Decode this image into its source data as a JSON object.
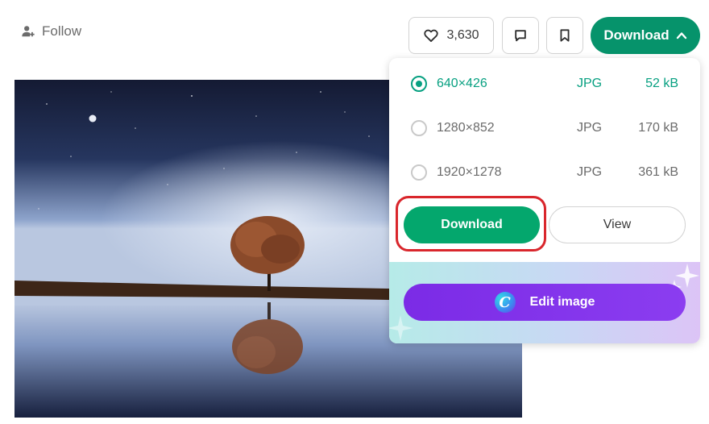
{
  "header": {
    "follow_label": "Follow",
    "like_count": "3,630",
    "download_label": "Download"
  },
  "photo": {
    "alt": "Lone tree at night reflected in water under a starry sky with the moon"
  },
  "dropdown": {
    "sizes": [
      {
        "dims": "640×426",
        "format": "JPG",
        "size": "52 kB",
        "selected": true
      },
      {
        "dims": "1280×852",
        "format": "JPG",
        "size": "170 kB",
        "selected": false
      },
      {
        "dims": "1920×1278",
        "format": "JPG",
        "size": "361 kB",
        "selected": false
      }
    ],
    "download_label": "Download",
    "view_label": "View",
    "edit_label": "Edit image",
    "canva_letter": "C"
  },
  "colors": {
    "accent_green": "#07a081",
    "download_green": "#04a76d",
    "edit_purple": "#7d2ae8",
    "highlight_red": "#d9262c"
  }
}
